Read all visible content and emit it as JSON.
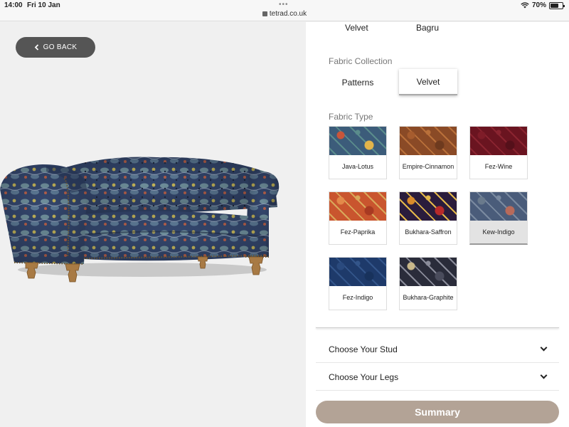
{
  "status_bar": {
    "time": "14:00",
    "date": "Fri 10 Jan",
    "url": "tetrad.co.uk",
    "battery_percent": "70%",
    "battery_level": 0.7
  },
  "left": {
    "back_label": "GO BACK",
    "back_icon": "chevron-left-icon"
  },
  "top_row": [
    "Velvet",
    "Bagru"
  ],
  "fabric_collection": {
    "label": "Fabric Collection",
    "options": [
      "Patterns",
      "Velvet"
    ],
    "selected": "Velvet"
  },
  "fabric_type": {
    "label": "Fabric Type",
    "selected": "Kew-Indigo",
    "swatches": [
      {
        "name": "Java-Lotus",
        "colors": [
          "#3c5c7a",
          "#c9553a",
          "#e3b44a",
          "#5a8c8c"
        ]
      },
      {
        "name": "Empire-Cinnamon",
        "colors": [
          "#8a4a26",
          "#a65c2e",
          "#6e3a1e",
          "#b9703a"
        ]
      },
      {
        "name": "Fez-Wine",
        "colors": [
          "#6a1420",
          "#7e1c28",
          "#55101a",
          "#8a2430"
        ]
      },
      {
        "name": "Fez-Paprika",
        "colors": [
          "#c9552e",
          "#e38a4a",
          "#a83a22",
          "#d9a85a"
        ]
      },
      {
        "name": "Bukhara-Saffron",
        "colors": [
          "#2a1c3c",
          "#d98a2a",
          "#b82a2a",
          "#e3b84a"
        ]
      },
      {
        "name": "Kew-Indigo",
        "colors": [
          "#4a5c7a",
          "#6a7a8c",
          "#b86a5a",
          "#7a8aa0"
        ]
      },
      {
        "name": "Fez-Indigo",
        "colors": [
          "#1e3a6a",
          "#2a4a7e",
          "#18325c",
          "#33558a"
        ]
      },
      {
        "name": "Bukhara-Graphite",
        "colors": [
          "#2a2c3a",
          "#c9b88a",
          "#4a4c5c",
          "#8a8c9a"
        ]
      }
    ]
  },
  "accordions": [
    {
      "label": "Choose Your Stud"
    },
    {
      "label": "Choose Your Legs"
    }
  ],
  "summary_label": "Summary",
  "colors": {
    "summary_button": "#b3a396",
    "back_button": "#555555"
  }
}
